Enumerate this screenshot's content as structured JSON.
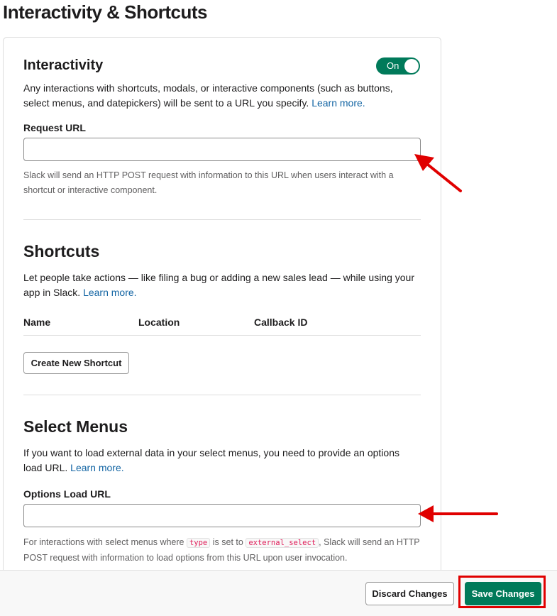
{
  "page": {
    "title": "Interactivity & Shortcuts"
  },
  "interactivity": {
    "heading": "Interactivity",
    "toggle_label": "On",
    "description": "Any interactions with shortcuts, modals, or interactive components (such as buttons, select menus, and datepickers) will be sent to a URL you specify.",
    "learn_more": "Learn more.",
    "request_url_label": "Request URL",
    "request_url_value": "",
    "request_url_help": "Slack will send an HTTP POST request with information to this URL when users interact with a shortcut or interactive component."
  },
  "shortcuts": {
    "heading": "Shortcuts",
    "description": "Let people take actions — like filing a bug or adding a new sales lead — while using your app in Slack.",
    "learn_more": "Learn more.",
    "columns": [
      "Name",
      "Location",
      "Callback ID"
    ],
    "create_button": "Create New Shortcut"
  },
  "select_menus": {
    "heading": "Select Menus",
    "description": "If you want to load external data in your select menus, you need to provide an options load URL.",
    "learn_more": "Learn more.",
    "options_url_label": "Options Load URL",
    "options_url_value": "",
    "help_part1": "For interactions with select menus where",
    "help_code1": "type",
    "help_part2": "is set to",
    "help_code2": "external_select",
    "help_part3": ", Slack will send an HTTP POST request with information to load options from this URL upon user invocation."
  },
  "footer": {
    "discard_label": "Discard Changes",
    "save_label": "Save Changes"
  },
  "colors": {
    "accent": "#007a5a",
    "link": "#1264a3",
    "annotation": "#e00000"
  }
}
